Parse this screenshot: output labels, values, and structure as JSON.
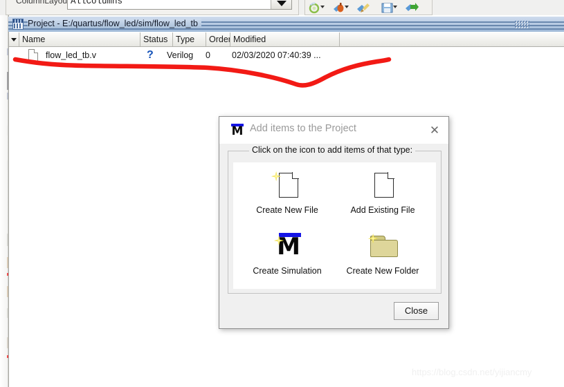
{
  "toolbar": {
    "column_layout_label": "ColumnLayout",
    "column_layout_value": "AllColumns",
    "dropdown_icon": "chevron-down-icon",
    "buttons": [
      {
        "name": "refresh-recycle-icon"
      },
      {
        "name": "compile-bottle-icon"
      },
      {
        "name": "compile-all-brush-icon"
      },
      {
        "name": "save-floppy-icon"
      },
      {
        "name": "simulate-arrow-icon"
      }
    ]
  },
  "panel": {
    "icon": "project-window-icon",
    "title": "Project - E:/quartus/flow_led/sim/flow_led_tb",
    "grip": "grip-dots-icon"
  },
  "table": {
    "sort_indicator": "sort-descending-icon",
    "columns": [
      "Name",
      "Status",
      "Type",
      "Order",
      "Modified"
    ],
    "rows": [
      {
        "file_icon": "file-document-icon",
        "name": "flow_led_tb.v",
        "status": "?",
        "type": "Verilog",
        "order": "0",
        "modified": "02/03/2020 07:40:39 ..."
      }
    ]
  },
  "annotation": {
    "name": "red-handdrawn-underline",
    "color": "#f21a15"
  },
  "dialog": {
    "logo": "modelsim-m-logo-icon",
    "title": "Add items to the Project",
    "close_icon": "close-icon",
    "group_legend": "Click on the icon to add items of that type:",
    "tiles": [
      {
        "icon": "new-file-icon",
        "label": "Create New File"
      },
      {
        "icon": "existing-file-icon",
        "label": "Add Existing File"
      },
      {
        "icon": "create-simulation-icon",
        "label": "Create Simulation"
      },
      {
        "icon": "new-folder-icon",
        "label": "Create New Folder"
      }
    ],
    "close_button": "Close"
  },
  "watermark": {
    "text": "https://blog.csdn.net/yijiancmy"
  }
}
